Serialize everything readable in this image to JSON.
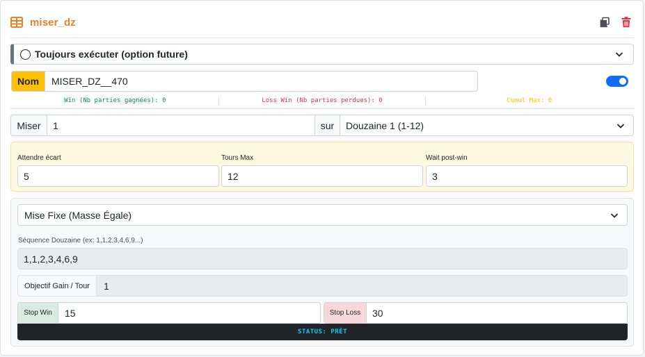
{
  "header": {
    "title": "miser_dz",
    "grid_icon": "table-grid-icon",
    "copy_icon": "copy-icon",
    "delete_icon": "trash-icon"
  },
  "toujours": {
    "label": "Toujours exécuter (option future)"
  },
  "nom": {
    "label": "Nom",
    "value": "MISER_DZ__470",
    "toggle_on": true
  },
  "stats": {
    "win": "Win (Nb parties gagnées): 0",
    "loss": "Loss Win (Nb parties perdues): 0",
    "cumul": "Cumul Max: 0"
  },
  "miser": {
    "label": "Miser",
    "value": "1",
    "sur_label": "sur",
    "target": "Douzaine 1 (1-12)"
  },
  "params": {
    "attendre_label": "Attendre écart",
    "attendre_value": "5",
    "tours_label": "Tours Max",
    "tours_value": "12",
    "wait_label": "Wait post-win",
    "wait_value": "3"
  },
  "mise": {
    "mode": "Mise Fixe (Masse Égale)",
    "sequence_label": "Séquence Douzaine (ex: 1,1,2,3,4,6,9...)",
    "sequence_value": "1,1,2,3,4,6,9",
    "objectif_label": "Objectif Gain / Tour",
    "objectif_value": "1",
    "stop_win_label": "Stop Win",
    "stop_win_value": "15",
    "stop_loss_label": "Stop Loss",
    "stop_loss_value": "30",
    "status": "STATUS: PRÊT"
  },
  "colors": {
    "accent": "#e8822a",
    "nom_badge": "#ffc107",
    "toggle": "#0d6efd",
    "win": "#198754",
    "loss": "#dc3545",
    "cumul": "#ffc107",
    "status_text": "#0dcaf0"
  }
}
